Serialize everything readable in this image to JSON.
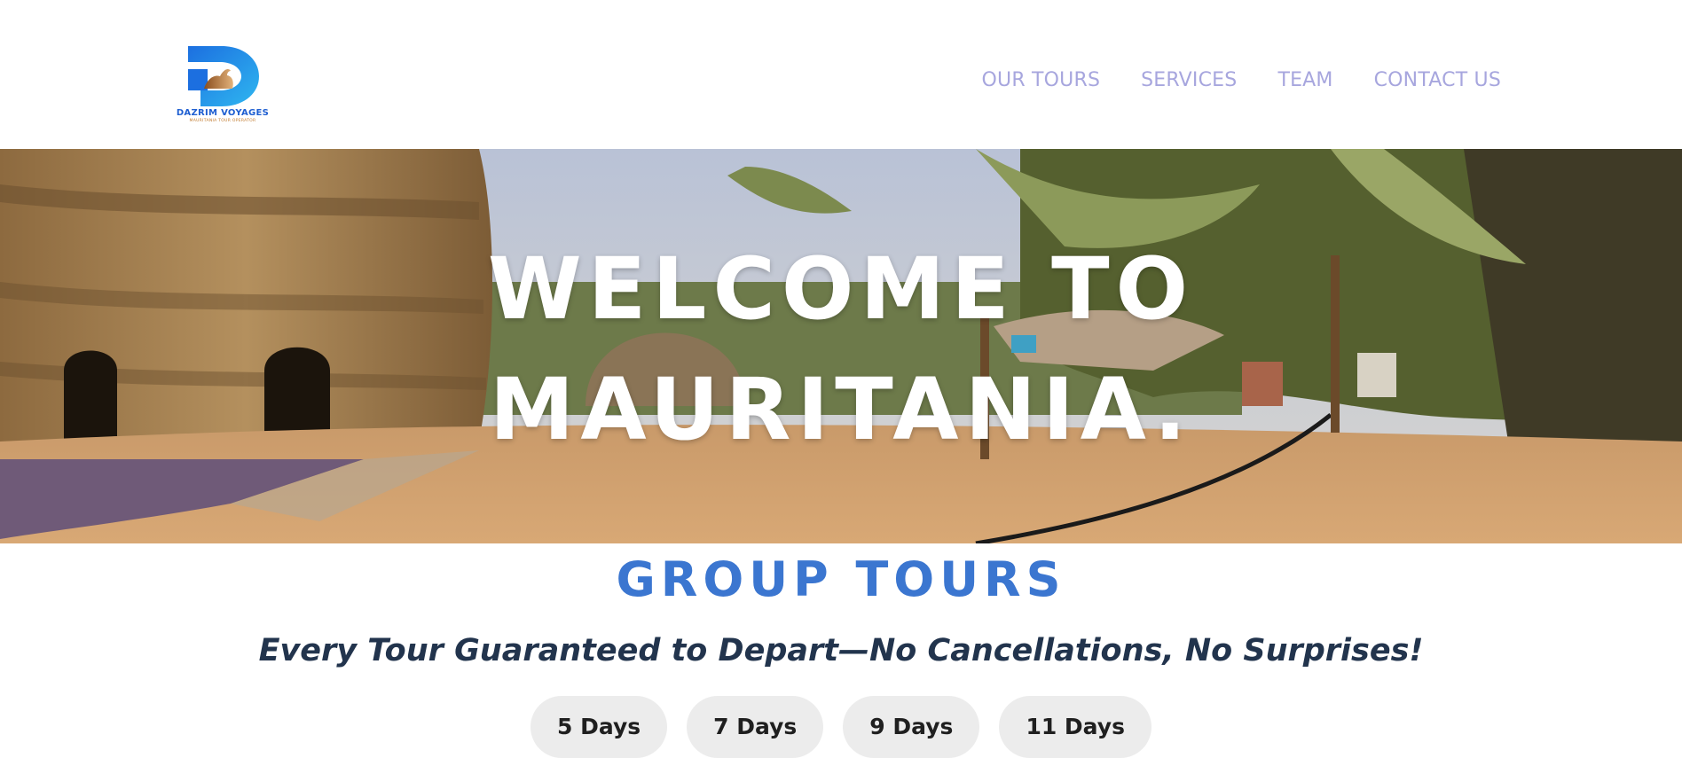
{
  "logo": {
    "name": "DAZRIM VOYAGES",
    "tagline": "MAURITANIA TOUR OPERATOR"
  },
  "nav": {
    "items": [
      {
        "label": "OUR TOURS"
      },
      {
        "label": "SERVICES"
      },
      {
        "label": "TEAM"
      },
      {
        "label": "CONTACT US"
      }
    ]
  },
  "hero": {
    "line1": "WELCOME TO",
    "line2": "MAURITANIA."
  },
  "group_tours": {
    "title": "GROUP TOURS",
    "subtitle": "Every Tour Guaranteed to Depart—No Cancellations, No Surprises!",
    "tabs": [
      {
        "label": "5 Days"
      },
      {
        "label": "7 Days"
      },
      {
        "label": "9 Days"
      },
      {
        "label": "11 Days"
      }
    ]
  },
  "colors": {
    "nav_text": "#a7a6de",
    "section_title": "#3b76d0",
    "subtitle": "#22344d",
    "tab_bg": "#ececec",
    "brand_blue": "#1f5fd1"
  }
}
